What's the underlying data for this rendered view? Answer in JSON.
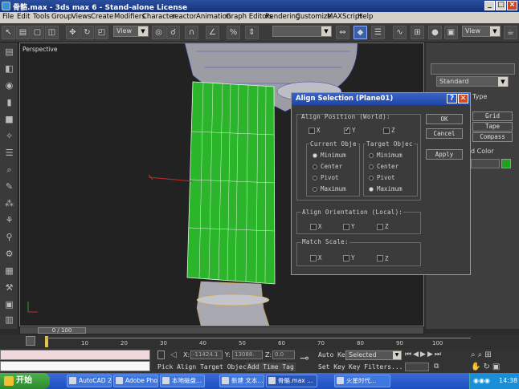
{
  "window": {
    "title": "骨骼.max - 3ds max 6 - Stand-alone License"
  },
  "menu": [
    "File",
    "Edit",
    "Tools",
    "Group",
    "Views",
    "Create",
    "Modifiers",
    "Character",
    "reactor",
    "Animation",
    "Graph Editors",
    "Rendering",
    "Customize",
    "MAXScript",
    "Help"
  ],
  "toolbar": {
    "view_dropdown": "View",
    "view_dropdown2": "View"
  },
  "viewport": {
    "label": "Perspective"
  },
  "command_panel": {
    "dropdown": "Standard",
    "rollout_label": "Type",
    "buttons": [
      "Grid",
      "Tape",
      "Compass"
    ],
    "color_label": "d Color",
    "object_color": "#1aa51a"
  },
  "dialog": {
    "title": "Align Selection (Plane01)",
    "help": "?",
    "close": "✕",
    "ok": "OK",
    "cancel": "Cancel",
    "apply": "Apply",
    "position_group": "Align Position (World):",
    "pos_x": "X",
    "pos_y": "Y",
    "pos_z": "Z",
    "pos_x_checked": false,
    "pos_y_checked": true,
    "pos_z_checked": false,
    "current_group": "Current Obje",
    "target_group": "Target Objec",
    "current_options": [
      "Minimum",
      "Center",
      "Pivot",
      "Maximum"
    ],
    "current_selected": 0,
    "target_options": [
      "Minimum",
      "Center",
      "Pivot",
      "Maximum"
    ],
    "target_selected": 3,
    "orientation_group": "Align Orientation (Local):",
    "ori_x": "X",
    "ori_y": "Y",
    "ori_z": "Z",
    "scale_group": "Match Scale:",
    "sc_x": "X",
    "sc_y": "Y",
    "sc_z": "Z"
  },
  "timeline": {
    "frame": "0 / 100",
    "ticks": [
      "0",
      "10",
      "20",
      "30",
      "40",
      "50",
      "60",
      "70",
      "80",
      "90",
      "100"
    ]
  },
  "status": {
    "prompt": "Pick Align Target Object",
    "add_time_tag": "Add Time Tag",
    "x_label": "X:",
    "x_value": "-11424.1",
    "y_label": "Y:",
    "y_value": "13088.",
    "z_label": "Z:",
    "z_value": "0.0",
    "auto_key": "Auto Key",
    "set_key": "Set Key",
    "selected": "Selected",
    "key_filters": "Key Filters..."
  },
  "taskbar": {
    "start": "开始",
    "tasks": [
      "AutoCAD 2...",
      "Adobe Pho...",
      "本地磁盘...",
      "新建 文本...",
      "骨骼.max ...",
      "火星时代..."
    ],
    "clock": "14:38"
  }
}
